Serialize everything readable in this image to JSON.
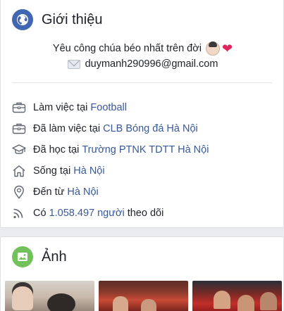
{
  "intro": {
    "title": "Giới thiệu",
    "bio_text": "Yêu công chúa béo nhất trên đời",
    "email": "duymanh290996@gmail.com",
    "items": [
      {
        "icon": "briefcase-icon",
        "prefix": "Làm việc tại ",
        "link": "Football",
        "suffix": ""
      },
      {
        "icon": "briefcase-icon",
        "prefix": "Đã làm việc tại ",
        "link": "CLB Bóng đá Hà Nội",
        "suffix": ""
      },
      {
        "icon": "graduation-cap-icon",
        "prefix": "Đã học tại ",
        "link": "Trường PTNK TDTT Hà Nội",
        "suffix": ""
      },
      {
        "icon": "home-icon",
        "prefix": "Sống tại ",
        "link": "Hà Nội",
        "suffix": ""
      },
      {
        "icon": "location-pin-icon",
        "prefix": "Đến từ ",
        "link": "Hà Nội",
        "suffix": ""
      },
      {
        "icon": "rss-feed-icon",
        "prefix": "Có ",
        "link": "1.058.497 người",
        "suffix": " theo dõi"
      }
    ]
  },
  "photos": {
    "title": "Ảnh"
  },
  "colors": {
    "link": "#385898",
    "globe_icon": "#4267b2",
    "photo_icon": "#72c15a",
    "heart": "#e0245e",
    "page_bg": "#e9ebee"
  }
}
